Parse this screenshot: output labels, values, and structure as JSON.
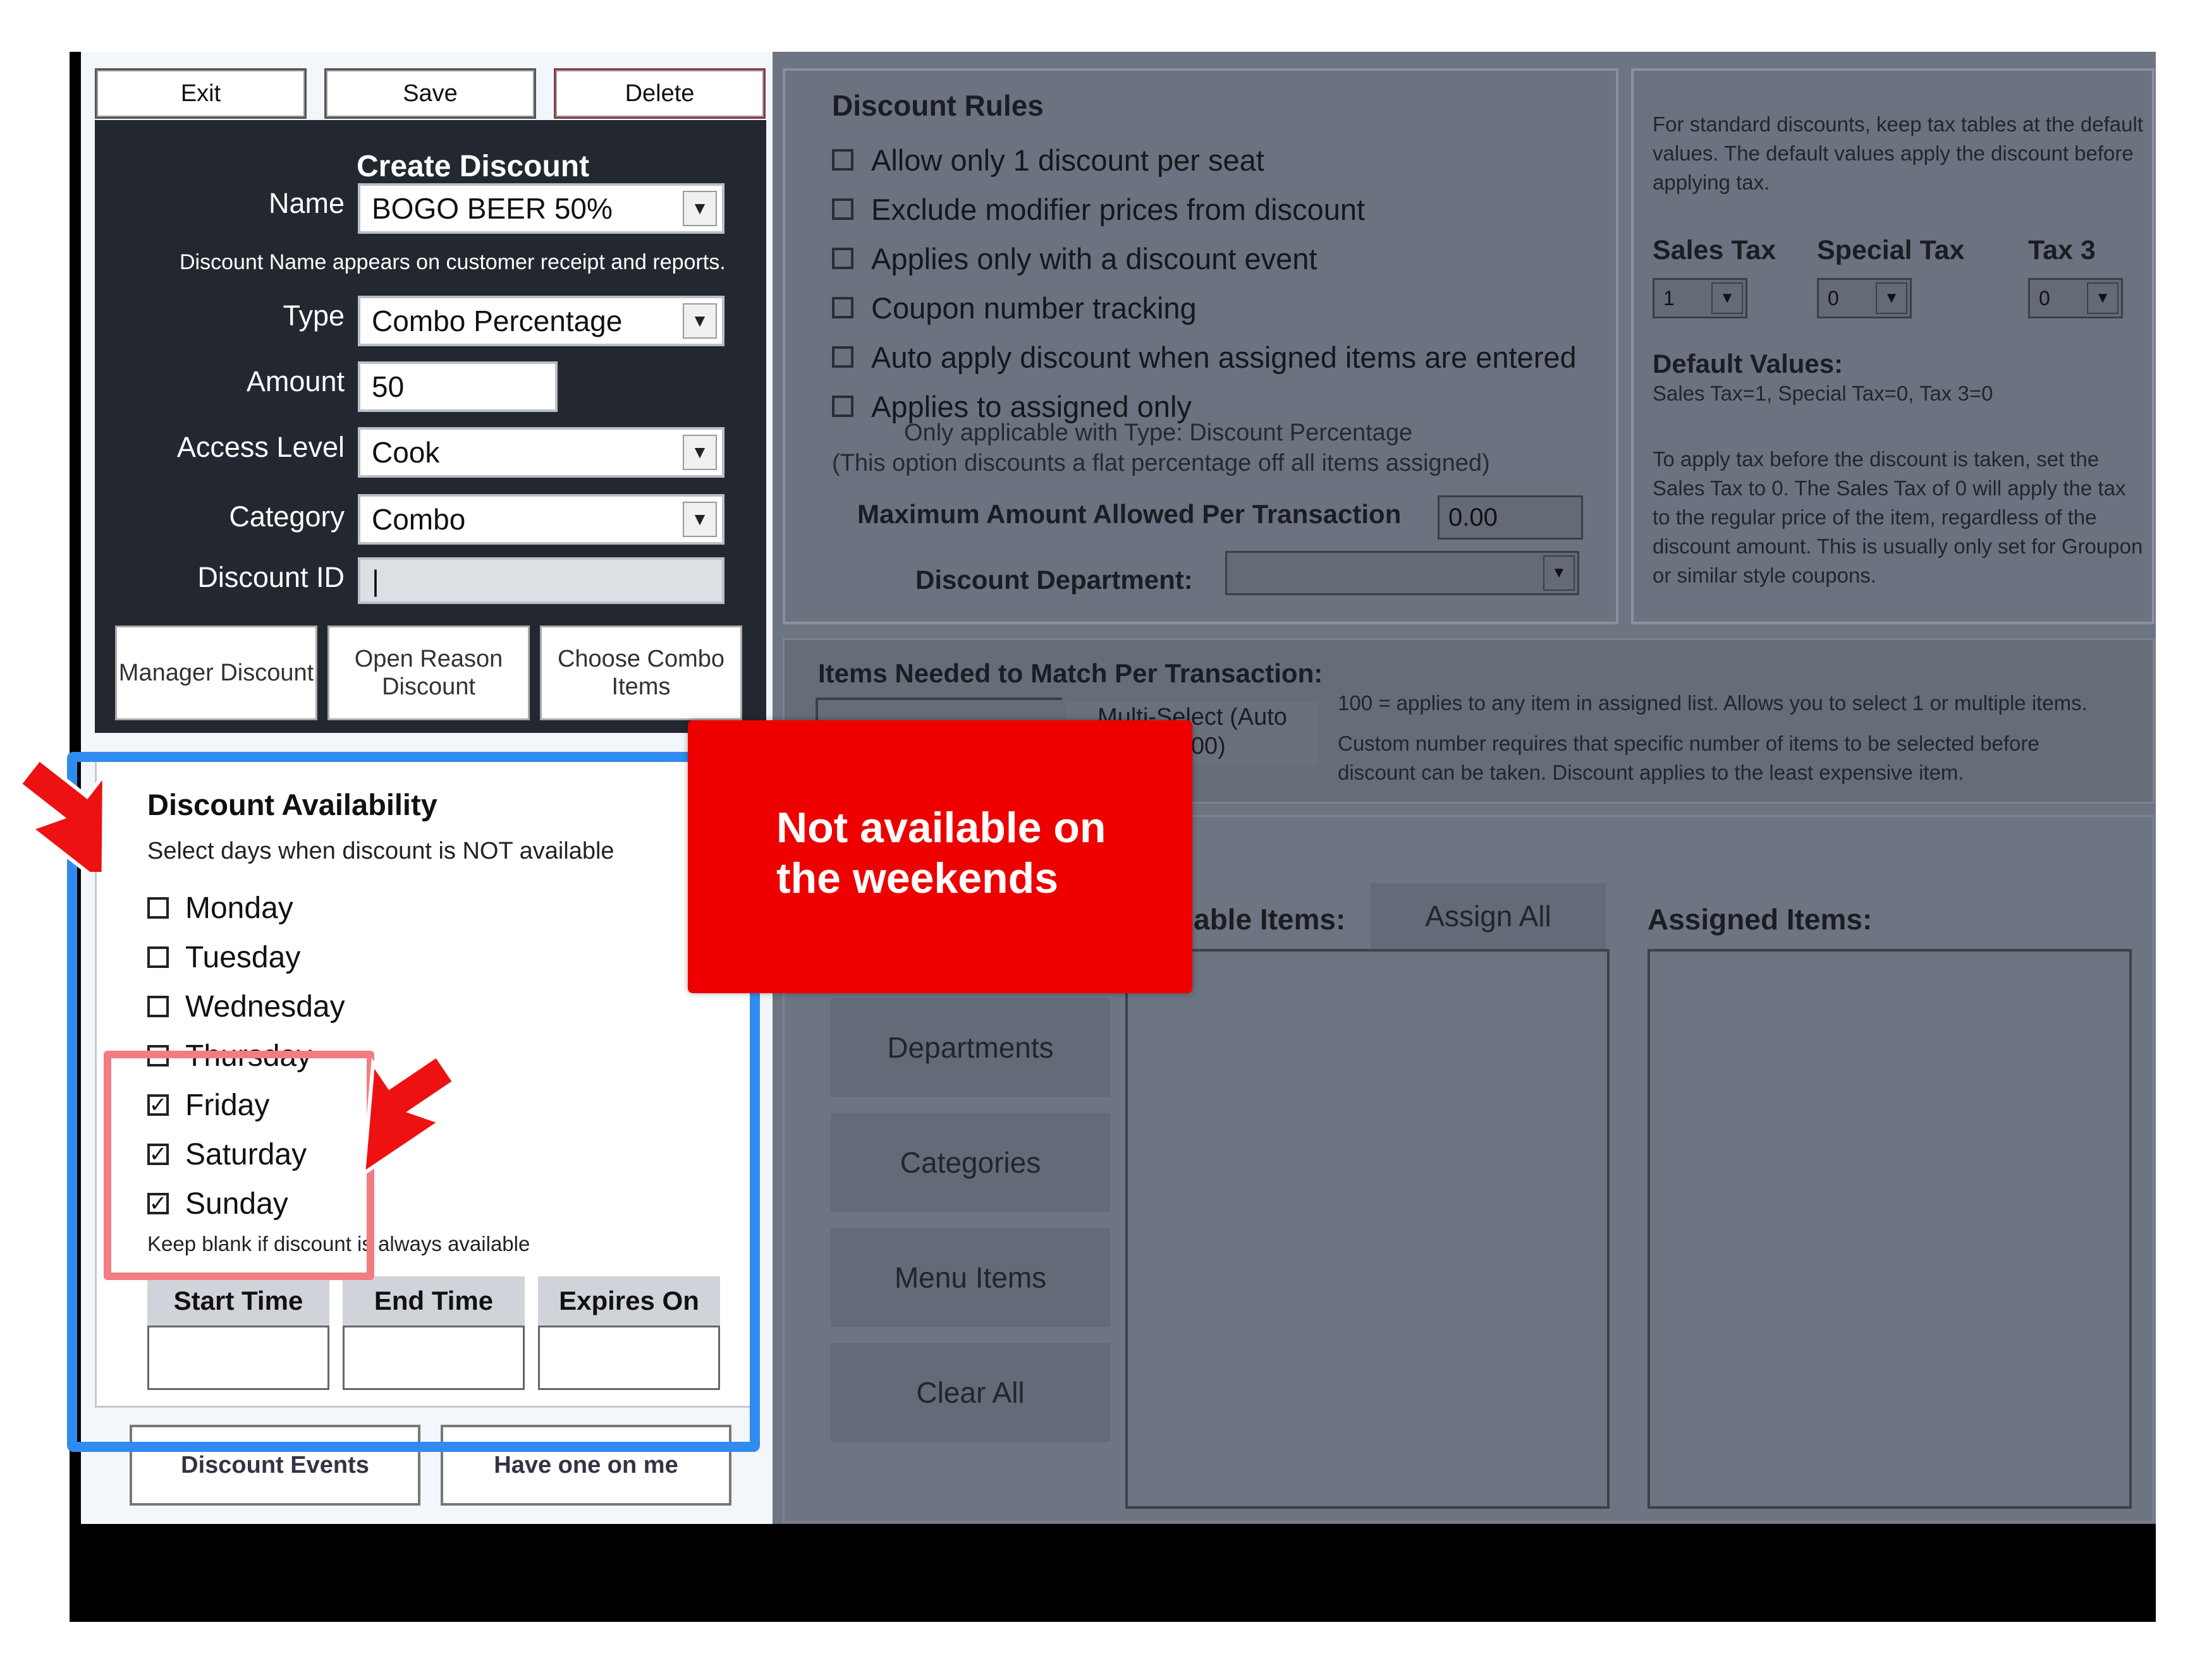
{
  "toolbar": {
    "exit": "Exit",
    "save": "Save",
    "delete": "Delete"
  },
  "create": {
    "title": "Create Discount",
    "name_label": "Name",
    "name_value": "BOGO BEER 50%",
    "name_hint": "Discount Name appears on customer receipt and reports.",
    "type_label": "Type",
    "type_value": "Combo Percentage",
    "amount_label": "Amount",
    "amount_value": "50",
    "access_label": "Access Level",
    "access_value": "Cook",
    "category_label": "Category",
    "category_value": "Combo",
    "discount_id_label": "Discount ID",
    "discount_id_value": "|",
    "btn_manager": "Manager Discount",
    "btn_open_reason": "Open Reason Discount",
    "btn_choose_combo": "Choose Combo Items"
  },
  "availability": {
    "title": "Discount Availability",
    "subtitle": "Select days when discount is NOT available",
    "days": [
      {
        "label": "Monday",
        "checked": false
      },
      {
        "label": "Tuesday",
        "checked": false
      },
      {
        "label": "Wednesday",
        "checked": false
      },
      {
        "label": "Thursday",
        "checked": false
      },
      {
        "label": "Friday",
        "checked": true
      },
      {
        "label": "Saturday",
        "checked": true
      },
      {
        "label": "Sunday",
        "checked": true
      }
    ],
    "hint": "Keep blank if discount is always available",
    "start_time": "Start Time",
    "end_time": "End Time",
    "expires_on": "Expires On"
  },
  "bottom": {
    "discount_events": "Discount Events",
    "have_one_on_me": "Have one on me"
  },
  "rules": {
    "title": "Discount Rules",
    "items": [
      "Allow only 1 discount per seat",
      "Exclude modifier prices from discount",
      "Applies only with a discount event",
      "Coupon number tracking",
      "Auto apply discount when assigned items are entered",
      "Applies to assigned only"
    ],
    "note1": "Only applicable with Type: Discount Percentage",
    "note2": "(This option discounts a flat percentage off all items assigned)",
    "max_label": "Maximum Amount Allowed Per Transaction",
    "max_value": "0.00",
    "dept_label": "Discount Department:"
  },
  "tax": {
    "intro": "For standard discounts, keep tax tables at the default values. The default values apply the discount before applying tax.",
    "sales_label": "Sales Tax",
    "special_label": "Special Tax",
    "tax3_label": "Tax 3",
    "sales_value": "1",
    "special_value": "0",
    "tax3_value": "0",
    "defaults_title": "Default Values:",
    "defaults_text": "Sales Tax=1, Special Tax=0, Tax 3=0",
    "note": "To apply tax before the discount is taken, set the Sales Tax to 0. The Sales Tax of 0 will apply the tax to the regular price of the item, regardless of the discount amount. This is usually only set for Groupon or similar style coupons."
  },
  "items_needed": {
    "title": "Items Needed to Match Per Transaction:",
    "multi_select": "Multi-Select (Auto",
    "multi_select_2": "s 100)",
    "desc1": "100 = applies to any item in assigned list. Allows you to select 1 or multiple items.",
    "desc2": "Custom number requires that specific number of items to be selected before discount can be taken. Discount applies to the least expensive item."
  },
  "assign": {
    "available_label": "able Items:",
    "assign_all": "Assign All",
    "assigned_label": "Assigned Items:",
    "departments": "Departments",
    "categories": "Categories",
    "menu_items": "Menu Items",
    "clear_all": "Clear All"
  },
  "callout": {
    "text": "Not available on the weekends"
  },
  "colors": {
    "callout": "#ee0000",
    "highlight_blue": "#2f8bf0",
    "highlight_pink": "#f37c82",
    "arrow": "#ee1111"
  },
  "icons": {
    "arrow_upper": "red-arrow-icon",
    "arrow_lower": "red-arrow-icon",
    "dropdown": "chevron-down-icon"
  }
}
